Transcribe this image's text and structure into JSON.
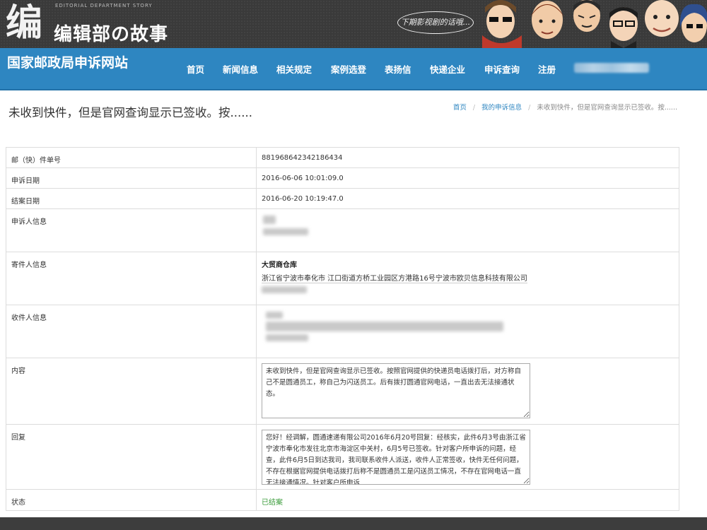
{
  "banner": {
    "logo_mark": "编",
    "subtitle": "EDITORIAL DEPARTMENT STORY",
    "title": "编辑部の故事",
    "speech": "下期影视剧的话哦..."
  },
  "nav": {
    "site_title": "国家邮政局申诉网站",
    "items": [
      "首页",
      "新闻信息",
      "相关规定",
      "案例选登",
      "表扬信",
      "快递企业",
      "申诉查询",
      "注册"
    ]
  },
  "page": {
    "title": "未收到快件，但是官网查询显示已签收。按......",
    "breadcrumb": {
      "home": "首页",
      "my_complaint": "我的申诉信息",
      "current": "未收到快件，但是官网查询显示已签收。按......"
    }
  },
  "details": {
    "tracking_label": "邮（快）件单号",
    "tracking_value": "881968642342186434",
    "complaint_date_label": "申诉日期",
    "complaint_date_value": "2016-06-06 10:01:09.0",
    "closed_date_label": "结案日期",
    "closed_date_value": "2016-06-20 10:19:47.0",
    "complainant_label": "申诉人信息",
    "sender_label": "寄件人信息",
    "sender_name": "大贸商仓库",
    "sender_address": "浙江省宁波市奉化市 江口街道方桥工业园区方港路16号宁波市欧贝信息科技有限公司",
    "recipient_label": "收件人信息",
    "content_label": "内容",
    "content_value": "未收到快件，但是官网查询显示已签收。按照官网提供的快递员电话拨打后，对方称自己不是圆通员工，称自己为闪送员工。后有拨打圆通官网电话，一直出去无法接通状态。",
    "reply_label": "回复",
    "reply_value": "您好！经调解，圆通速递有限公司2016年6月20号回复：经核实，此件6月3号由浙江省宁波市奉化市发往北京市海淀区中关村，6月5号已签收。针对客户所申诉的问题，经查，此件6月5日到达我司，我司联系收件人派送，收件人正常签收，快件无任何问题，不存在根据官网提供电话拨打后称不是圆通员工是闪送员工情况，不存在官网电话一直无法接通情况。针对客户所申诉",
    "status_label": "状态",
    "status_value": "已结案"
  },
  "colors": {
    "nav_blue": "#2e86c1",
    "status_green": "#3a9b3a",
    "banner_dark": "#3a3a3a"
  }
}
